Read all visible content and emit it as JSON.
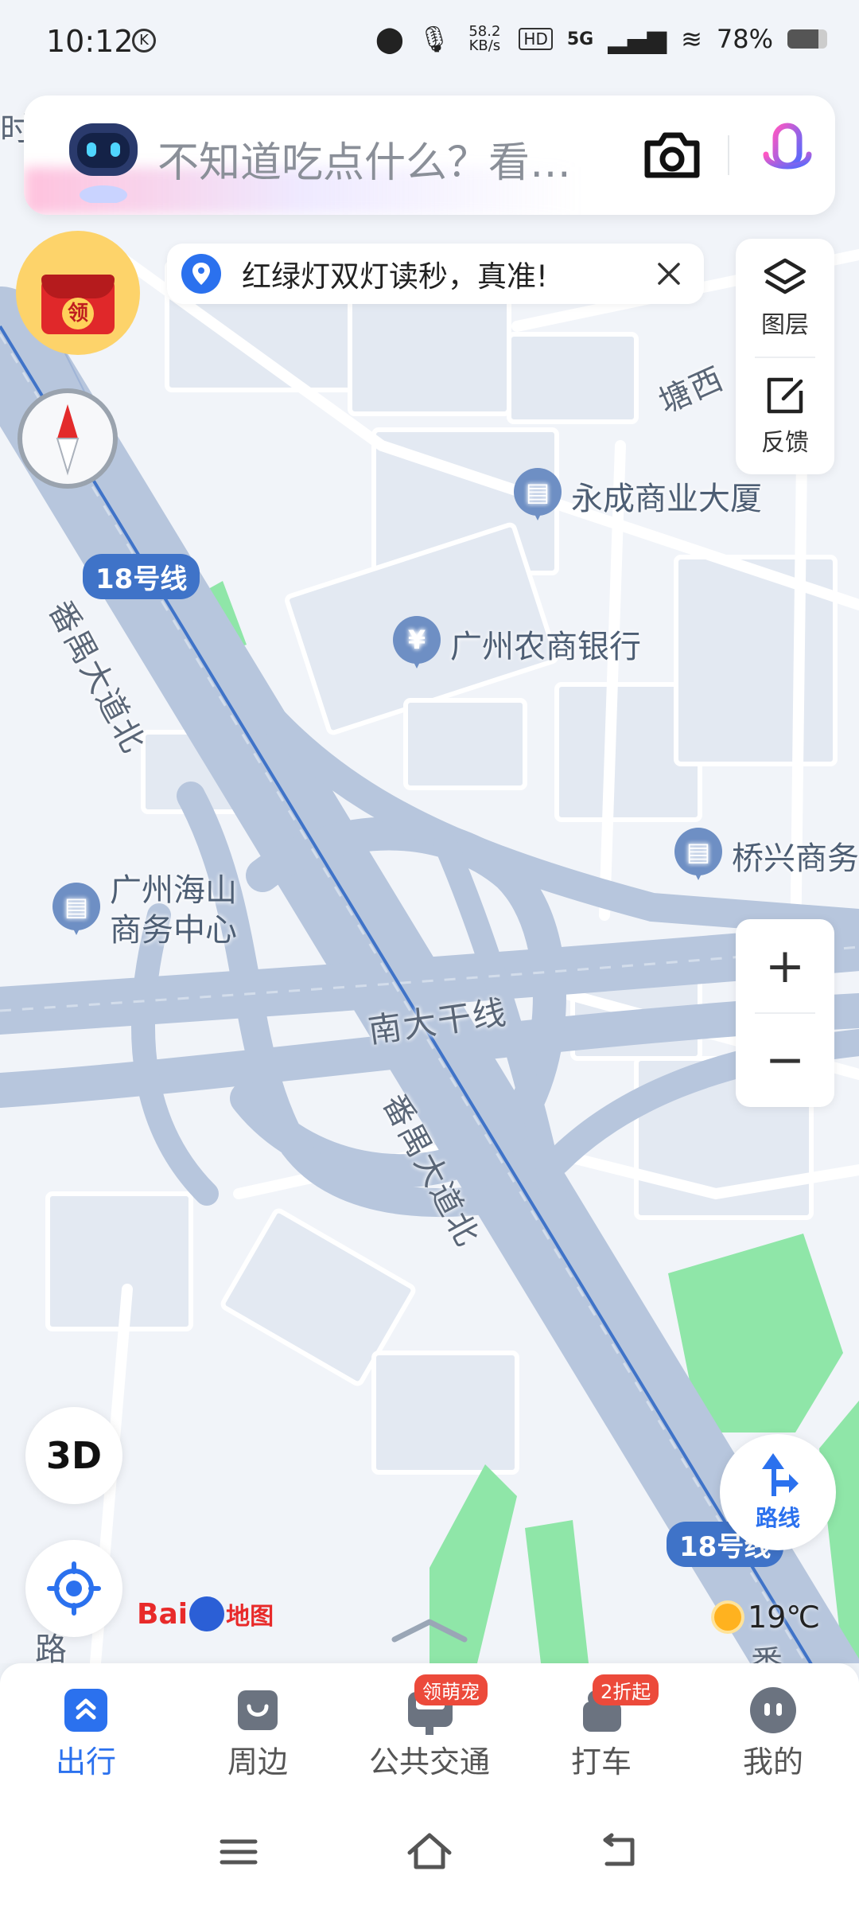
{
  "status_bar": {
    "time": "10:12",
    "net_speed": "58.2 KB/s",
    "hd": "HD",
    "network": "5G",
    "battery": "78%"
  },
  "search": {
    "placeholder": "不知道吃点什么？看…"
  },
  "notice": {
    "text": "红绿灯双灯读秒，真准!"
  },
  "red_packet": {
    "label": "领"
  },
  "tools": {
    "layers_label": "图层",
    "feedback_label": "反馈"
  },
  "map": {
    "roads": {
      "panyu_north_1": "番禺大道北",
      "panyu_north_2": "番禺大道北",
      "nanda": "南大干线",
      "tangxi": "塘西",
      "partial_left": "路",
      "partial_top": "时",
      "partial_bottom_right": "番"
    },
    "line_badges": [
      "18号线",
      "18号线"
    ],
    "pois": {
      "yongcheng": "永成商业大厦",
      "bank": "广州农商银行",
      "qiaoxing": "桥兴商务",
      "haishan_line1": "广州海山",
      "haishan_line2": "商务中心"
    },
    "bank_symbol": "¥"
  },
  "controls": {
    "zoom_in": "+",
    "zoom_out": "−",
    "three_d": "3D",
    "route_label": "路线",
    "logo_text": "Bai",
    "logo_text2": "地图",
    "weather": "19℃"
  },
  "bottom_nav": {
    "items": [
      {
        "label": "出行"
      },
      {
        "label": "周边"
      },
      {
        "label": "公共交通",
        "tag": "领萌宠"
      },
      {
        "label": "打车",
        "tag": "2折起"
      },
      {
        "label": "我的"
      }
    ]
  },
  "colors": {
    "accent": "#2b71ee",
    "road": "#b7c6dd",
    "metro": "#3f73c8",
    "green": "#8fe6a8",
    "tag": "#ec4a3b"
  }
}
